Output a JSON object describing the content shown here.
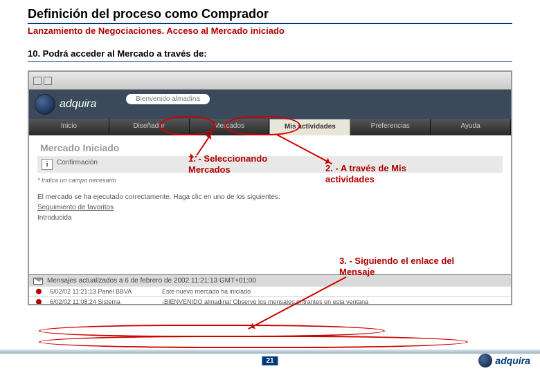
{
  "title": "Definición del proceso como Comprador",
  "subtitle": "Lanzamiento de Negociaciones. Acceso al Mercado iniciado",
  "step_line": "10.  Podrá acceder al Mercado a través de:",
  "app": {
    "logo_text": "adquira",
    "welcome": "Bienvenido almadina",
    "nav": [
      "Inicio",
      "Diseñador",
      "Mercados",
      "Mis actividades",
      "Preferencias",
      "Ayuda"
    ],
    "section_title": "Mercado Iniciado",
    "confirm_label": "Confirmación",
    "required_note": "* Indica un campo necesario",
    "body_line": "El mercado se ha ejecutado correctamente.  Haga clic en uno de los siguientes:",
    "body_link": "Seguimiento de favoritos",
    "body_tail": "Introducida",
    "msg_strip": "Mensajes actualizados a  6 de febrero de 2002 11:21:13 GMT+01:00",
    "msg_rows": [
      {
        "date": "6/02/02 11:21:13  Panel BBVA",
        "text": "Este nuevo mercado ha iniciado"
      },
      {
        "date": "6/02/02 11:08:24  Sistema",
        "text": "¡BIENVENIDO almadina!  Observe los mensajes entrantes en esta ventana"
      }
    ]
  },
  "annotations": {
    "a1": "1. -  Seleccionando Mercados",
    "a2": "2. - A través de Mis actividades",
    "a3": "3. - Siguiendo el enlace del Mensaje"
  },
  "page_number": "21",
  "footer_logo": "adquira"
}
